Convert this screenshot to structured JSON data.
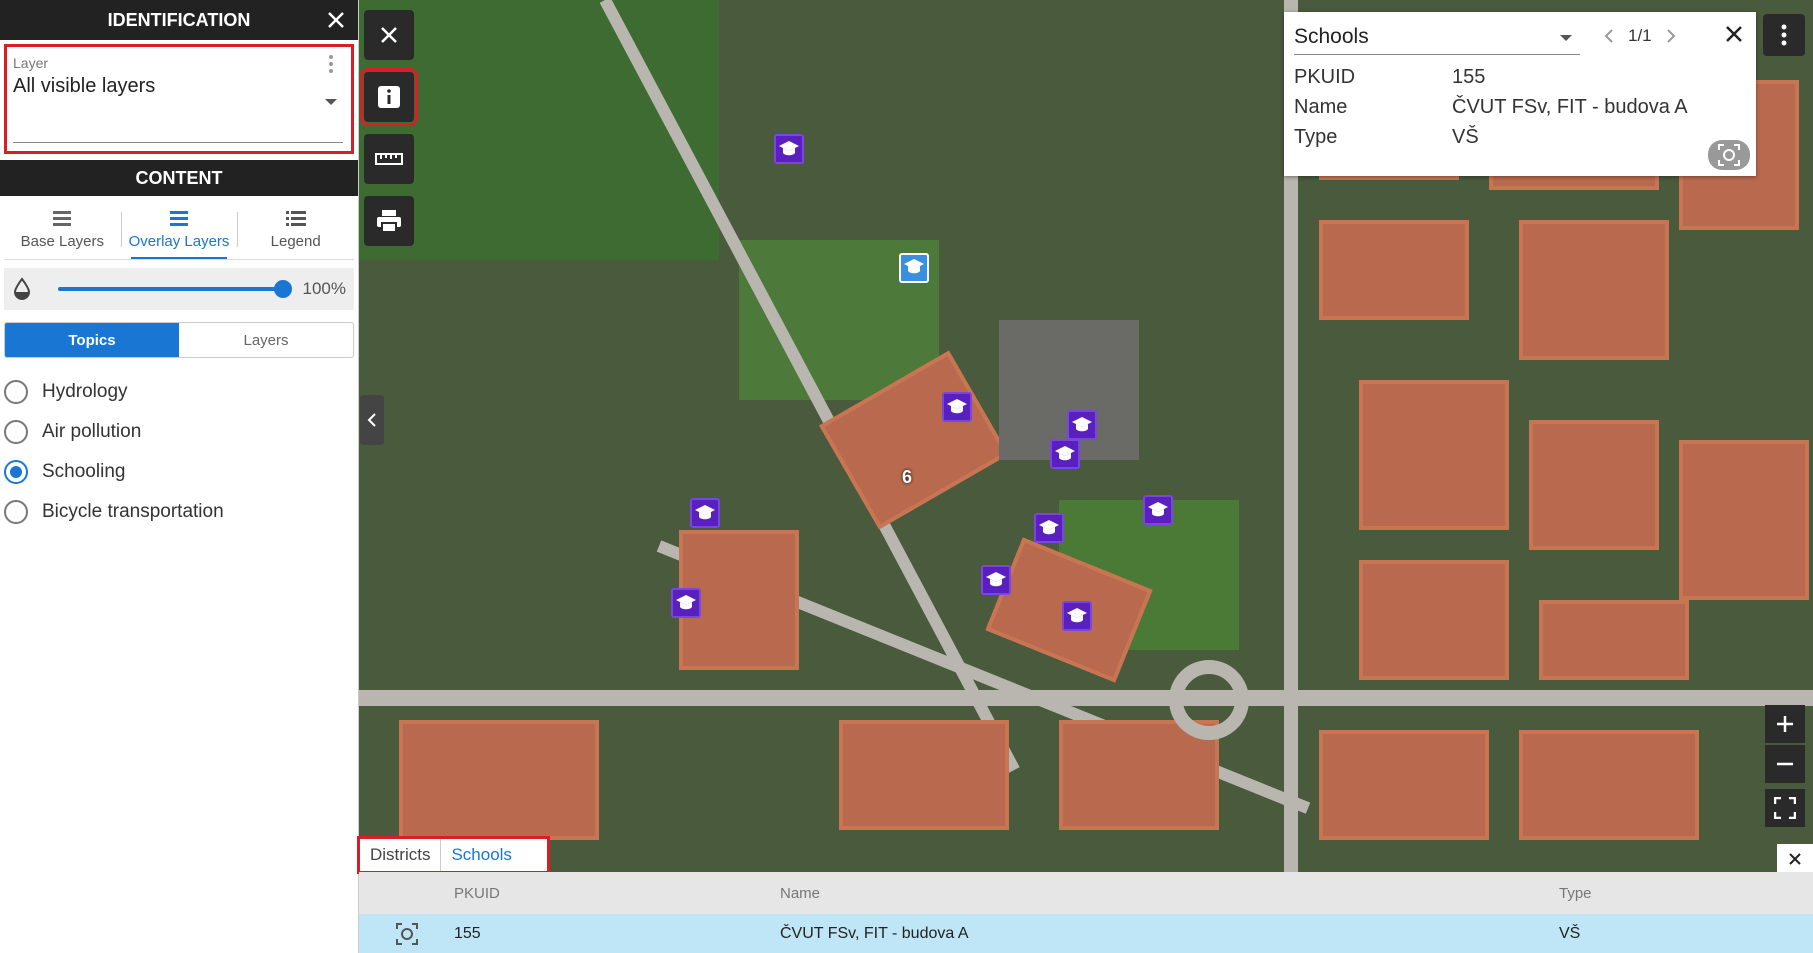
{
  "identification": {
    "title": "IDENTIFICATION",
    "layer_label": "Layer",
    "layer_value": "All visible layers"
  },
  "content": {
    "title": "CONTENT",
    "tabs": [
      {
        "label": "Base Layers",
        "icon": "base-layers-icon"
      },
      {
        "label": "Overlay Layers",
        "icon": "overlay-layers-icon",
        "active": true
      },
      {
        "label": "Legend",
        "icon": "legend-list-icon"
      }
    ],
    "opacity": "100%",
    "segment": {
      "topics": "Topics",
      "layers": "Layers"
    },
    "topics": [
      {
        "label": "Hydrology",
        "selected": false
      },
      {
        "label": "Air pollution",
        "selected": false
      },
      {
        "label": "Schooling",
        "selected": true
      },
      {
        "label": "Bicycle transportation",
        "selected": false
      }
    ]
  },
  "map": {
    "cluster_count": "6",
    "colors": {
      "school_marker": "#5a1fbf",
      "accent": "#1976d2",
      "highlight": "#d61f26"
    }
  },
  "popup": {
    "layer": "Schools",
    "pager": "1/1",
    "rows": [
      {
        "key": "PKUID",
        "value": "155"
      },
      {
        "key": "Name",
        "value": "ČVUT FSv, FIT - budova A"
      },
      {
        "key": "Type",
        "value": "VŠ"
      }
    ]
  },
  "attribute_tabs": [
    "Districts",
    "Schools"
  ],
  "attribute_table": {
    "headers": [
      "PKUID",
      "Name",
      "Type"
    ],
    "rows": [
      {
        "pkuid": "155",
        "name": "ČVUT FSv, FIT - budova A",
        "type": "VŠ"
      }
    ]
  }
}
